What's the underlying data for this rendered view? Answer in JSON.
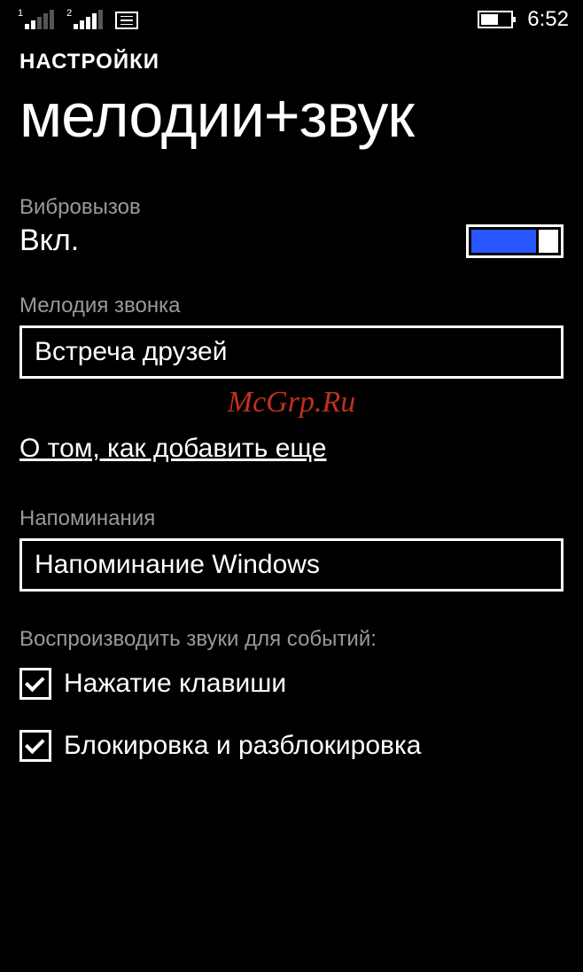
{
  "statusbar": {
    "sim1": "1",
    "sim2": "2",
    "time": "6:52"
  },
  "breadcrumb": "НАСТРОЙКИ",
  "title": "мелодии+звук",
  "vibrate": {
    "label": "Вибровызов",
    "value": "Вкл."
  },
  "ringtone": {
    "label": "Мелодия звонка",
    "value": "Встреча друзей"
  },
  "watermark": "McGrp.Ru",
  "add_more_link": "О том, как добавить еще",
  "reminders": {
    "label": "Напоминания",
    "value": "Напоминание Windows"
  },
  "events": {
    "header": "Воспроизводить звуки для событий:",
    "keypress": "Нажатие клавиши",
    "lock": "Блокировка и разблокировка"
  }
}
